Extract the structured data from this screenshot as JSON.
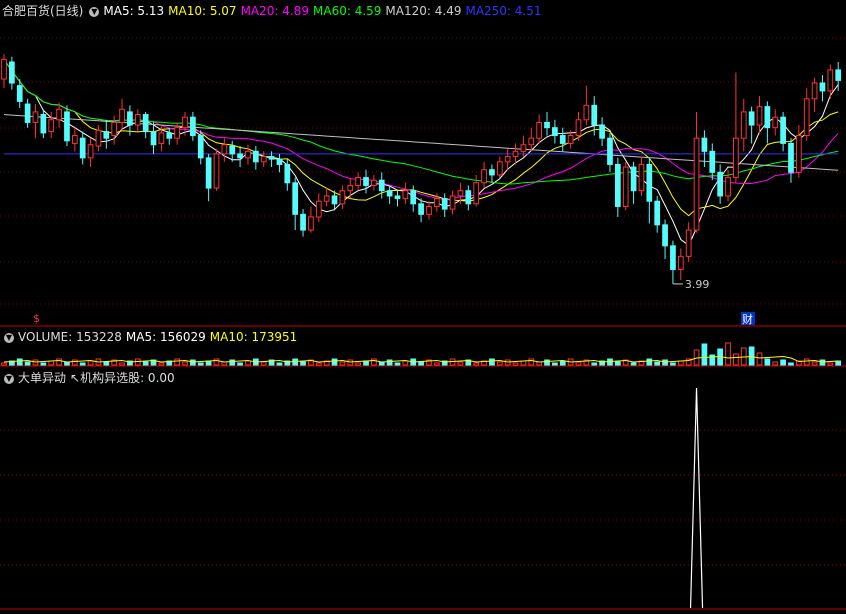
{
  "colors": {
    "up": "#ff3232",
    "down": "#54fcfc",
    "ma5": "#ffffff",
    "ma10": "#ffff00",
    "ma20": "#ff00ff",
    "ma60": "#00ff00",
    "ma120": "#c0c0c0",
    "ma250": "#3333ff",
    "grid": "#8b0000"
  },
  "header": {
    "title": "合肥百货(日线)",
    "ma5": "MA5: 5.13",
    "ma10": "MA10: 5.07",
    "ma20": "MA20: 4.89",
    "ma60": "MA60: 4.59",
    "ma120": "MA120: 4.49",
    "ma250": "MA250: 4.51"
  },
  "volume_header": {
    "vol": "VOLUME: 153228",
    "ma5": "MA5: 156029",
    "ma10": "MA10: 173951"
  },
  "indicator_header": {
    "name": "大单异动",
    "value": "↖机构异选股: 0.00"
  },
  "annotations": {
    "low_label": "3.99",
    "dividend_marker": "$",
    "finance_marker": "财"
  },
  "chart_data": {
    "type": "candlestick",
    "ylim": [
      3.7,
      6.0
    ],
    "candles": [
      [
        5.55,
        5.7,
        5.48,
        5.74
      ],
      [
        5.68,
        5.52,
        5.47,
        5.72
      ],
      [
        5.5,
        5.38,
        5.33,
        5.55
      ],
      [
        5.36,
        5.22,
        5.18,
        5.4
      ],
      [
        5.22,
        5.3,
        5.1,
        5.36
      ],
      [
        5.28,
        5.14,
        5.1,
        5.32
      ],
      [
        5.15,
        5.24,
        5.1,
        5.3
      ],
      [
        5.24,
        5.32,
        5.18,
        5.37
      ],
      [
        5.3,
        5.08,
        5.04,
        5.35
      ],
      [
        5.06,
        5.12,
        5.0,
        5.18
      ],
      [
        5.1,
        4.95,
        4.9,
        5.15
      ],
      [
        4.95,
        5.05,
        4.88,
        5.1
      ],
      [
        5.04,
        5.16,
        5.0,
        5.2
      ],
      [
        5.15,
        5.1,
        5.02,
        5.24
      ],
      [
        5.12,
        5.22,
        5.05,
        5.27
      ],
      [
        5.22,
        5.32,
        5.15,
        5.4
      ],
      [
        5.3,
        5.2,
        5.12,
        5.35
      ],
      [
        5.2,
        5.28,
        5.15,
        5.32
      ],
      [
        5.28,
        5.15,
        5.1,
        5.3
      ],
      [
        5.15,
        5.05,
        4.98,
        5.22
      ],
      [
        5.06,
        5.14,
        5.0,
        5.2
      ],
      [
        5.14,
        5.1,
        5.05,
        5.18
      ],
      [
        5.1,
        5.18,
        5.05,
        5.22
      ],
      [
        5.18,
        5.26,
        5.12,
        5.3
      ],
      [
        5.26,
        5.12,
        5.08,
        5.3
      ],
      [
        5.12,
        4.95,
        4.9,
        5.16
      ],
      [
        4.95,
        4.72,
        4.62,
        4.98
      ],
      [
        4.72,
        4.98,
        4.7,
        5.02
      ],
      [
        4.98,
        5.05,
        4.92,
        5.1
      ],
      [
        5.04,
        4.98,
        4.92,
        5.08
      ],
      [
        4.98,
        4.95,
        4.88,
        5.04
      ],
      [
        4.95,
        5.0,
        4.9,
        5.05
      ],
      [
        5.0,
        4.92,
        4.86,
        5.04
      ],
      [
        4.92,
        4.96,
        4.88,
        5.0
      ],
      [
        4.96,
        4.94,
        4.88,
        5.0
      ],
      [
        4.94,
        4.9,
        4.84,
        4.98
      ],
      [
        4.9,
        4.76,
        4.7,
        4.94
      ],
      [
        4.76,
        4.52,
        4.4,
        4.8
      ],
      [
        4.52,
        4.4,
        4.35,
        4.56
      ],
      [
        4.4,
        4.5,
        4.38,
        4.58
      ],
      [
        4.5,
        4.62,
        4.46,
        4.68
      ],
      [
        4.62,
        4.66,
        4.58,
        4.72
      ],
      [
        4.66,
        4.6,
        4.55,
        4.7
      ],
      [
        4.6,
        4.7,
        4.56,
        4.74
      ],
      [
        4.7,
        4.74,
        4.64,
        4.8
      ],
      [
        4.74,
        4.8,
        4.7,
        4.84
      ],
      [
        4.8,
        4.74,
        4.68,
        4.86
      ],
      [
        4.74,
        4.78,
        4.7,
        4.82
      ],
      [
        4.78,
        4.7,
        4.64,
        4.84
      ],
      [
        4.7,
        4.66,
        4.6,
        4.74
      ],
      [
        4.66,
        4.64,
        4.58,
        4.7
      ],
      [
        4.64,
        4.7,
        4.6,
        4.76
      ],
      [
        4.7,
        4.6,
        4.54,
        4.74
      ],
      [
        4.6,
        4.52,
        4.46,
        4.64
      ],
      [
        4.52,
        4.58,
        4.48,
        4.62
      ],
      [
        4.58,
        4.64,
        4.54,
        4.68
      ],
      [
        4.64,
        4.56,
        4.5,
        4.68
      ],
      [
        4.56,
        4.66,
        4.52,
        4.7
      ],
      [
        4.66,
        4.7,
        4.6,
        4.76
      ],
      [
        4.7,
        4.6,
        4.55,
        4.74
      ],
      [
        4.6,
        4.76,
        4.58,
        4.82
      ],
      [
        4.76,
        4.86,
        4.72,
        4.92
      ],
      [
        4.86,
        4.82,
        4.76,
        4.9
      ],
      [
        4.82,
        4.92,
        4.8,
        4.96
      ],
      [
        4.92,
        4.96,
        4.86,
        5.02
      ],
      [
        4.96,
        5.0,
        4.9,
        5.06
      ],
      [
        5.0,
        5.05,
        4.96,
        5.12
      ],
      [
        5.05,
        5.1,
        5.0,
        5.18
      ],
      [
        5.1,
        5.22,
        5.06,
        5.28
      ],
      [
        5.22,
        5.18,
        5.12,
        5.3
      ],
      [
        5.18,
        5.12,
        5.06,
        5.24
      ],
      [
        5.12,
        5.06,
        5.0,
        5.18
      ],
      [
        5.06,
        5.12,
        5.02,
        5.16
      ],
      [
        5.12,
        5.24,
        5.08,
        5.3
      ],
      [
        5.24,
        5.35,
        5.2,
        5.5
      ],
      [
        5.35,
        5.2,
        5.12,
        5.42
      ],
      [
        5.2,
        5.1,
        5.04,
        5.26
      ],
      [
        5.1,
        4.9,
        4.84,
        5.14
      ],
      [
        4.9,
        4.58,
        4.5,
        4.95
      ],
      [
        4.58,
        4.88,
        4.55,
        4.92
      ],
      [
        4.88,
        4.7,
        4.6,
        4.92
      ],
      [
        4.7,
        4.9,
        4.66,
        4.96
      ],
      [
        4.9,
        4.62,
        4.45,
        4.95
      ],
      [
        4.62,
        4.44,
        4.38,
        4.66
      ],
      [
        4.44,
        4.28,
        4.18,
        4.48
      ],
      [
        4.28,
        4.1,
        3.99,
        4.32
      ],
      [
        4.1,
        4.2,
        4.02,
        4.26
      ],
      [
        4.2,
        4.4,
        4.16,
        4.46
      ],
      [
        4.4,
        5.1,
        4.38,
        5.3
      ],
      [
        5.1,
        5.0,
        4.88,
        5.16
      ],
      [
        5.0,
        4.84,
        4.78,
        5.06
      ],
      [
        4.84,
        4.66,
        4.6,
        4.9
      ],
      [
        4.66,
        4.8,
        4.62,
        4.86
      ],
      [
        4.8,
        5.1,
        4.76,
        5.6
      ],
      [
        5.1,
        5.3,
        5.0,
        5.4
      ],
      [
        5.3,
        5.2,
        5.06,
        5.34
      ],
      [
        5.2,
        5.34,
        5.14,
        5.42
      ],
      [
        5.34,
        5.18,
        5.06,
        5.38
      ],
      [
        5.18,
        5.26,
        5.12,
        5.32
      ],
      [
        5.26,
        5.06,
        5.0,
        5.3
      ],
      [
        5.06,
        4.84,
        4.76,
        5.1
      ],
      [
        4.84,
        5.12,
        4.8,
        5.2
      ],
      [
        5.12,
        5.4,
        5.08,
        5.48
      ],
      [
        5.4,
        5.52,
        5.3,
        5.56
      ],
      [
        5.52,
        5.46,
        5.38,
        5.58
      ],
      [
        5.46,
        5.62,
        5.4,
        5.66
      ],
      [
        5.62,
        5.54,
        5.46,
        5.68
      ]
    ],
    "indicator_peak_index": 88
  }
}
